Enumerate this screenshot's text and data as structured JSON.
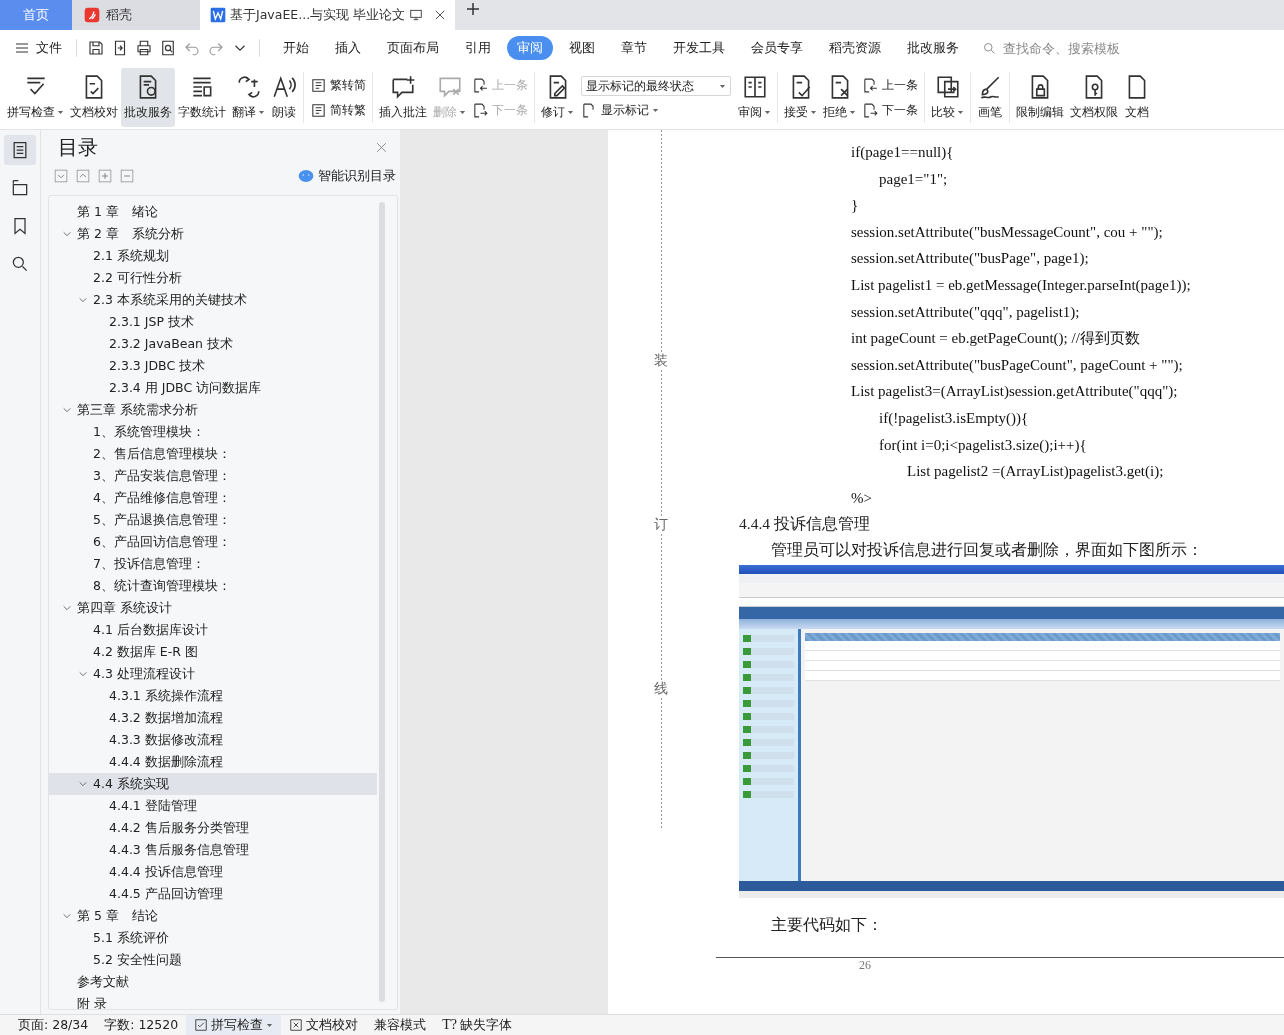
{
  "tabs": [
    {
      "kind": "home",
      "label": "首页",
      "selected": false
    },
    {
      "kind": "app",
      "label": "稻壳",
      "selected": false
    },
    {
      "kind": "document",
      "label": "基于JavaEE...与实现 毕业论文",
      "selected": true
    }
  ],
  "menu": {
    "file_label": "文件",
    "tabs": [
      {
        "label": "开始",
        "selected": false
      },
      {
        "label": "插入",
        "selected": false
      },
      {
        "label": "页面布局",
        "selected": false
      },
      {
        "label": "引用",
        "selected": false
      },
      {
        "label": "审阅",
        "selected": true
      },
      {
        "label": "视图",
        "selected": false
      },
      {
        "label": "章节",
        "selected": false
      },
      {
        "label": "开发工具",
        "selected": false
      },
      {
        "label": "会员专享",
        "selected": false
      },
      {
        "label": "稻壳资源",
        "selected": false
      },
      {
        "label": "批改服务",
        "selected": false
      }
    ],
    "search": {
      "placeholder": "查找命令、搜索模板"
    }
  },
  "ribbon": [
    {
      "kind": "large",
      "label": "拼写检查",
      "dropdown": true,
      "disabled": false,
      "selected": false
    },
    {
      "kind": "large",
      "label": "文档校对",
      "dropdown": false,
      "disabled": false,
      "selected": false
    },
    {
      "kind": "large",
      "label": "批改服务",
      "dropdown": false,
      "disabled": false,
      "selected": true
    },
    {
      "kind": "large",
      "label": "字数统计",
      "dropdown": false,
      "disabled": false,
      "selected": false
    },
    {
      "kind": "large",
      "label": "翻译",
      "dropdown": true,
      "disabled": false,
      "selected": false
    },
    {
      "kind": "large",
      "label": "朗读",
      "dropdown": false,
      "disabled": false,
      "selected": false
    },
    {
      "kind": "separator"
    },
    {
      "kind": "pair",
      "items": [
        {
          "label": "繁转简",
          "disabled": false
        },
        {
          "label": "简转繁",
          "disabled": false
        }
      ]
    },
    {
      "kind": "separator"
    },
    {
      "kind": "large",
      "label": "插入批注",
      "dropdown": false,
      "disabled": false,
      "selected": false
    },
    {
      "kind": "large",
      "label": "删除",
      "dropdown": true,
      "disabled": true,
      "selected": false
    },
    {
      "kind": "pair",
      "items": [
        {
          "label": "上一条",
          "disabled": true
        },
        {
          "label": "下一条",
          "disabled": true
        }
      ]
    },
    {
      "kind": "separator"
    },
    {
      "kind": "large",
      "label": "修订",
      "dropdown": true,
      "disabled": false,
      "selected": false
    },
    {
      "kind": "select",
      "value": "显示标记的最终状态",
      "below": {
        "label": "显示标记",
        "dropdown": true
      }
    },
    {
      "kind": "large",
      "label": "审阅",
      "dropdown": true,
      "disabled": false,
      "selected": false
    },
    {
      "kind": "separator"
    },
    {
      "kind": "large",
      "label": "接受",
      "dropdown": true,
      "disabled": false,
      "selected": false
    },
    {
      "kind": "large",
      "label": "拒绝",
      "dropdown": true,
      "disabled": false,
      "selected": false
    },
    {
      "kind": "pair",
      "items": [
        {
          "label": "上一条",
          "disabled": false
        },
        {
          "label": "下一条",
          "disabled": false
        }
      ]
    },
    {
      "kind": "separator"
    },
    {
      "kind": "large",
      "label": "比较",
      "dropdown": true,
      "disabled": false,
      "selected": false
    },
    {
      "kind": "separator"
    },
    {
      "kind": "large",
      "label": "画笔",
      "dropdown": false,
      "disabled": false,
      "selected": false
    },
    {
      "kind": "separator"
    },
    {
      "kind": "large",
      "label": "限制编辑",
      "dropdown": false,
      "disabled": false,
      "selected": false
    },
    {
      "kind": "large",
      "label": "文档权限",
      "dropdown": false,
      "disabled": false,
      "selected": false
    },
    {
      "kind": "large",
      "label": "文档",
      "dropdown": false,
      "disabled": false,
      "selected": false
    }
  ],
  "nav_rail": [
    {
      "selected": true
    },
    {
      "selected": false
    },
    {
      "selected": false
    },
    {
      "selected": false
    }
  ],
  "toc": {
    "title": "目录",
    "smart_label": "智能识别目录",
    "items": [
      {
        "label": "第 1 章　绪论",
        "selected": false
      },
      {
        "label": "第 2 章　系统分析",
        "selected": false,
        "expanded": true,
        "children": [
          {
            "label": "2.1  系统规划",
            "selected": false
          },
          {
            "label": "2.2  可行性分析",
            "selected": false
          },
          {
            "label": "2.3  本系统采用的关键技术",
            "selected": false,
            "expanded": true,
            "children": [
              {
                "label": "2.3.1 JSP 技术",
                "selected": false
              },
              {
                "label": "2.3.2 JavaBean 技术",
                "selected": false
              },
              {
                "label": "2.3.3 JDBC 技术",
                "selected": false
              },
              {
                "label": "2.3.4  用 JDBC 访问数据库",
                "selected": false
              }
            ]
          }
        ]
      },
      {
        "label": "第三章  系统需求分析",
        "selected": false,
        "expanded": true,
        "children": [
          {
            "label": "1、系统管理模块：",
            "selected": false
          },
          {
            "label": "2、售后信息管理模块：",
            "selected": false
          },
          {
            "label": "3、产品安装信息管理：",
            "selected": false
          },
          {
            "label": "4、产品维修信息管理：",
            "selected": false
          },
          {
            "label": "5、产品退换信息管理：",
            "selected": false
          },
          {
            "label": "6、产品回访信息管理：",
            "selected": false
          },
          {
            "label": "7、投诉信息管理：",
            "selected": false
          },
          {
            "label": "8、统计查询管理模块：",
            "selected": false
          }
        ]
      },
      {
        "label": "第四章  系统设计",
        "selected": false,
        "expanded": true,
        "children": [
          {
            "label": "4.1  后台数据库设计",
            "selected": false
          },
          {
            "label": "4.2  数据库 E-R 图",
            "selected": false
          },
          {
            "label": "4.3  处理流程设计",
            "selected": false,
            "expanded": true,
            "children": [
              {
                "label": "4.3.1  系统操作流程",
                "selected": false
              },
              {
                "label": "4.3.2  数据增加流程",
                "selected": false
              },
              {
                "label": "4.3.3  数据修改流程",
                "selected": false
              },
              {
                "label": "4.4.4  数据删除流程",
                "selected": false
              }
            ]
          },
          {
            "label": "4.4  系统实现",
            "selected": true,
            "expanded": true,
            "children": [
              {
                "label": "4.4.1  登陆管理",
                "selected": false
              },
              {
                "label": "4.4.2  售后服务分类管理",
                "selected": false
              },
              {
                "label": "4.4.3  售后服务信息管理",
                "selected": false
              },
              {
                "label": "4.4.4  投诉信息管理",
                "selected": false
              },
              {
                "label": "4.4.5  产品回访管理",
                "selected": false
              }
            ]
          }
        ]
      },
      {
        "label": "第 5 章　结论",
        "selected": false,
        "expanded": true,
        "children": [
          {
            "label": "5.1  系统评价",
            "selected": false
          },
          {
            "label": "5.2  安全性问题",
            "selected": false
          }
        ]
      },
      {
        "label": "参考文献",
        "selected": false
      },
      {
        "label": "附  录",
        "selected": false
      }
    ]
  },
  "document": {
    "margin_marks": [
      "装",
      "订",
      "线"
    ],
    "code_lines": [
      {
        "kind": "flush",
        "text": "if(page1==null){"
      },
      {
        "kind": "indent",
        "text": "page1=\"1\";"
      },
      {
        "kind": "flush",
        "text": "}"
      },
      {
        "kind": "flush",
        "text": "session.setAttribute(\"busMessageCount\", cou + \"\");"
      },
      {
        "kind": "flush",
        "text": "session.setAttribute(\"busPage\", page1);"
      },
      {
        "kind": "flush",
        "text": "List pagelist1 = eb.getMessage(Integer.parseInt(page1));"
      },
      {
        "kind": "flush",
        "text": "session.setAttribute(\"qqq\", pagelist1);"
      },
      {
        "kind": "flush",
        "text": "int pageCount = eb.getPageCount(); //得到页数"
      },
      {
        "kind": "flush",
        "text": "session.setAttribute(\"busPageCount\", pageCount + \"\");"
      },
      {
        "kind": "flush",
        "text": "List pagelist3=(ArrayList)session.getAttribute(\"qqq\");"
      },
      {
        "kind": "indent",
        "text": "if(!pagelist3.isEmpty()){"
      },
      {
        "kind": "indent",
        "text": "for(int i=0;i<pagelist3.size();i++){"
      },
      {
        "kind": "indent2",
        "text": "List pagelist2 =(ArrayList)pagelist3.get(i);"
      },
      {
        "kind": "flush",
        "text": "%>"
      }
    ],
    "heading": "4.4.4  投诉信息管理",
    "paragraph": "管理员可以对投诉信息进行回复或者删除，界面如下图所示：",
    "after_figure": "主要代码如下：",
    "page_number": "26"
  },
  "status_bar": [
    {
      "kind": "text",
      "label": "页面: 28/34"
    },
    {
      "kind": "text",
      "label": "字数: 12520"
    },
    {
      "kind": "button",
      "label": "拼写检查",
      "dropdown": true
    },
    {
      "kind": "button",
      "label": "文档校对",
      "dropdown": false
    },
    {
      "kind": "text",
      "label": "兼容模式"
    },
    {
      "kind": "glyph-button",
      "label": "缺失字体",
      "glyph": "T?"
    }
  ]
}
